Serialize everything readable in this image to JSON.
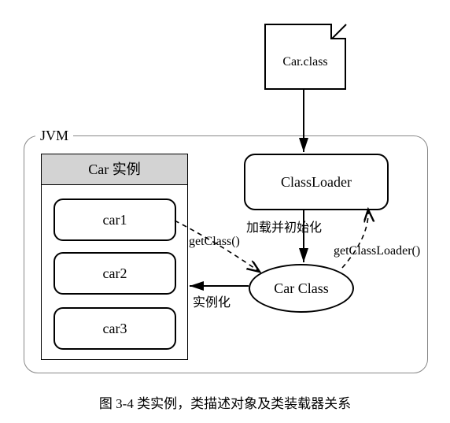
{
  "diagram": {
    "file_label": "Car.class",
    "jvm_label": "JVM",
    "instances": {
      "title": "Car 实例",
      "items": [
        "car1",
        "car2",
        "car3"
      ]
    },
    "classloader_label": "ClassLoader",
    "carclass_label": "Car Class",
    "edges": {
      "load": "加载并初始化",
      "getclass": "getClass()",
      "getloader": "getClassLoader()",
      "instantiate": "实例化"
    }
  },
  "caption": "图 3-4  类实例，类描述对象及类装载器关系",
  "chart_data": {
    "type": "diagram",
    "title": "类实例，类描述对象及类装载器关系",
    "nodes": [
      {
        "id": "file",
        "label": "Car.class",
        "kind": "file"
      },
      {
        "id": "jvm",
        "label": "JVM",
        "kind": "container"
      },
      {
        "id": "instances",
        "label": "Car 实例",
        "kind": "group",
        "children": [
          "car1",
          "car2",
          "car3"
        ]
      },
      {
        "id": "car1",
        "label": "car1",
        "kind": "instance"
      },
      {
        "id": "car2",
        "label": "car2",
        "kind": "instance"
      },
      {
        "id": "car3",
        "label": "car3",
        "kind": "instance"
      },
      {
        "id": "classloader",
        "label": "ClassLoader",
        "kind": "object"
      },
      {
        "id": "carclass",
        "label": "Car Class",
        "kind": "class"
      }
    ],
    "edges": [
      {
        "from": "file",
        "to": "classloader",
        "label": "",
        "style": "solid"
      },
      {
        "from": "classloader",
        "to": "carclass",
        "label": "加载并初始化",
        "style": "solid"
      },
      {
        "from": "carclass",
        "to": "instances",
        "label": "实例化",
        "style": "solid"
      },
      {
        "from": "car1",
        "to": "carclass",
        "label": "getClass()",
        "style": "dashed"
      },
      {
        "from": "carclass",
        "to": "classloader",
        "label": "getClassLoader()",
        "style": "dashed"
      }
    ]
  }
}
